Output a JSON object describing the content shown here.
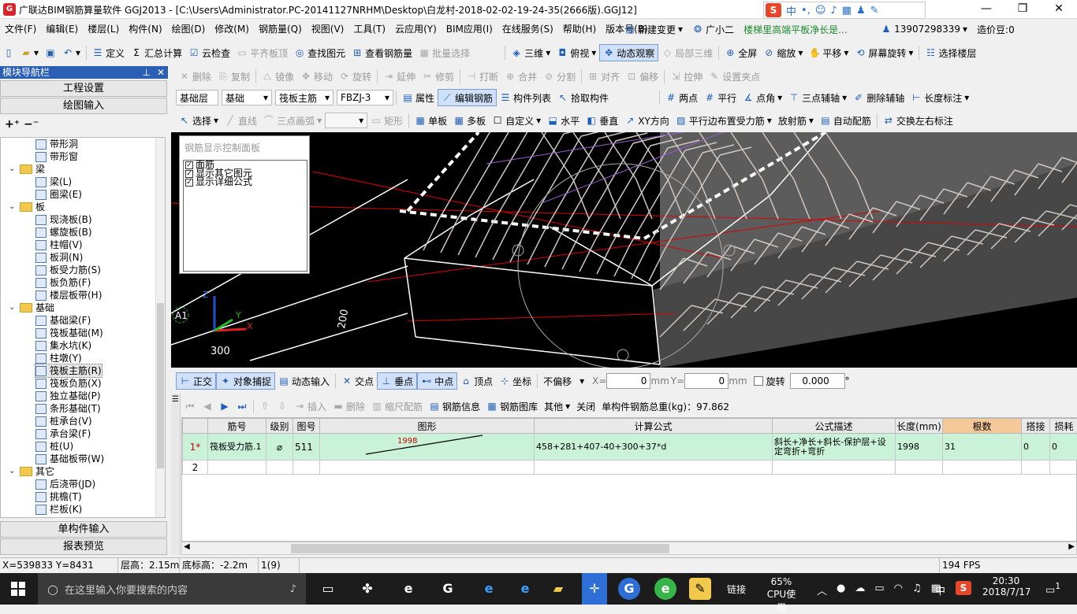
{
  "window": {
    "title": "广联达BIM钢筋算量软件 GGJ2013 - [C:\\Users\\Administrator.PC-20141127NRHM\\Desktop\\白龙村-2018-02-02-19-24-35(2666版).GGJ12]",
    "minimize": "—",
    "restore": "❐",
    "close": "✕"
  },
  "ime": {
    "logo": "S",
    "mode": "中"
  },
  "menu": [
    "文件(F)",
    "编辑(E)",
    "楼层(L)",
    "构件(N)",
    "绘图(D)",
    "修改(M)",
    "钢筋量(Q)",
    "视图(V)",
    "工具(T)",
    "云应用(Y)",
    "BIM应用(I)",
    "在线服务(S)",
    "帮助(H)",
    "版本号(B)"
  ],
  "menu_right": {
    "new_change": "新建变更",
    "assistant": "广小二",
    "notice": "楼梯里高端平板净长是...",
    "phone": "13907298339",
    "credit": "造价豆:0"
  },
  "toolbar1": {
    "define": "定义",
    "sum": "汇总计算",
    "cloud_check": "云检查",
    "flat_top": "平齐板顶",
    "find": "查找图元",
    "view_rebar": "查看钢筋量",
    "batch": "批量选择",
    "view3d": "三维",
    "top_view": "俯视",
    "dynamic": "动态观察",
    "local3d": "局部三维",
    "fullscreen": "全屏",
    "zoom": "缩放",
    "pan": "平移",
    "rotate_screen": "屏幕旋转",
    "select_floor": "选择楼层"
  },
  "toolbar2": [
    "删除",
    "复制",
    "镜像",
    "移动",
    "旋转",
    "延伸",
    "修剪",
    "打断",
    "合并",
    "分割",
    "对齐",
    "偏移",
    "拉伸",
    "设置夹点"
  ],
  "toolbar3": {
    "layer": "基础层",
    "type": "基础",
    "member": "筏板主筋",
    "name": "FBZJ-3",
    "props": "属性",
    "edit_rebar": "编辑钢筋",
    "list": "构件列表",
    "pick": "拾取构件",
    "two_point": "两点",
    "parallel": "平行",
    "point_angle": "点角",
    "three_point_aux": "三点辅轴",
    "del_aux": "删除辅轴",
    "dim": "长度标注"
  },
  "toolbar4": {
    "select": "选择",
    "line": "直线",
    "arc": "三点画弧",
    "rect": "矩形",
    "single": "单板",
    "multi": "多板",
    "custom": "自定义",
    "horizontal": "水平",
    "vertical": "垂直",
    "xy": "XY方向",
    "parallel_edge": "平行边布置受力筋",
    "radial": "放射筋",
    "auto": "自动配筋",
    "swap": "交换左右标注"
  },
  "panel": {
    "title": "模块导航栏",
    "engineering": "工程设置",
    "drawing": "绘图输入",
    "single_input": "单构件输入",
    "report": "报表预览"
  },
  "tree": [
    {
      "label": "带形洞",
      "level": 2,
      "folder": false
    },
    {
      "label": "带形窗",
      "level": 2,
      "folder": false
    },
    {
      "label": "梁",
      "level": 1,
      "folder": true
    },
    {
      "label": "梁(L)",
      "level": 2,
      "folder": false
    },
    {
      "label": "圈梁(E)",
      "level": 2,
      "folder": false
    },
    {
      "label": "板",
      "level": 1,
      "folder": true
    },
    {
      "label": "现浇板(B)",
      "level": 2,
      "folder": false
    },
    {
      "label": "螺旋板(B)",
      "level": 2,
      "folder": false
    },
    {
      "label": "柱帽(V)",
      "level": 2,
      "folder": false
    },
    {
      "label": "板洞(N)",
      "level": 2,
      "folder": false
    },
    {
      "label": "板受力筋(S)",
      "level": 2,
      "folder": false
    },
    {
      "label": "板负筋(F)",
      "level": 2,
      "folder": false
    },
    {
      "label": "楼层板带(H)",
      "level": 2,
      "folder": false
    },
    {
      "label": "基础",
      "level": 1,
      "folder": true
    },
    {
      "label": "基础梁(F)",
      "level": 2,
      "folder": false
    },
    {
      "label": "筏板基础(M)",
      "level": 2,
      "folder": false
    },
    {
      "label": "集水坑(K)",
      "level": 2,
      "folder": false
    },
    {
      "label": "柱墩(Y)",
      "level": 2,
      "folder": false
    },
    {
      "label": "筏板主筋(R)",
      "level": 2,
      "folder": false
    },
    {
      "label": "筏板负筋(X)",
      "level": 2,
      "folder": false
    },
    {
      "label": "独立基础(P)",
      "level": 2,
      "folder": false
    },
    {
      "label": "条形基础(T)",
      "level": 2,
      "folder": false
    },
    {
      "label": "桩承台(V)",
      "level": 2,
      "folder": false
    },
    {
      "label": "承台梁(F)",
      "level": 2,
      "folder": false
    },
    {
      "label": "桩(U)",
      "level": 2,
      "folder": false
    },
    {
      "label": "基础板带(W)",
      "level": 2,
      "folder": false
    },
    {
      "label": "其它",
      "level": 1,
      "folder": true
    },
    {
      "label": "后浇带(JD)",
      "level": 2,
      "folder": false
    },
    {
      "label": "挑檐(T)",
      "level": 2,
      "folder": false
    },
    {
      "label": "栏板(K)",
      "level": 2,
      "folder": false
    }
  ],
  "ctrl_panel": {
    "title": "钢筋显示控制面板",
    "items": [
      "面筋",
      "显示其它图元",
      "显示详细公式"
    ]
  },
  "canvas": {
    "axis_label": "A1",
    "dim1": "200",
    "dim2": "300",
    "z": "Z",
    "x": "X",
    "y": "Y"
  },
  "snapbar": {
    "ortho": "正交",
    "snap": "对象捕捉",
    "dyn_input": "动态输入",
    "intersection": "交点",
    "perp": "垂点",
    "mid": "中点",
    "vertex": "顶点",
    "coord": "坐标",
    "offset_mode": "不偏移",
    "x_label": "X=",
    "x_val": "0",
    "y_label": "Y=",
    "y_val": "0",
    "unit": "mm",
    "rotate": "旋转",
    "rotate_val": "0.000",
    "deg": "°"
  },
  "gridbar": {
    "insert": "插入",
    "delete": "删除",
    "scale": "缩尺配筋",
    "info": "钢筋信息",
    "lib": "钢筋图库",
    "other": "其他",
    "close": "关闭",
    "weight": "单构件钢筋总重(kg)：97.862"
  },
  "grid": {
    "headers": [
      "筋号",
      "级别",
      "图号",
      "图形",
      "计算公式",
      "公式描述",
      "长度(mm)",
      "根数",
      "搭接",
      "损耗"
    ],
    "rows": [
      {
        "idx": "1*",
        "name": "筏板受力筋.1",
        "grade": "⌀",
        "fig": "511",
        "shape_label": "1998",
        "formula": "458+281+407-40+300+37*d",
        "desc": "斜长+净长+斜长-保护层+设定弯折+弯折",
        "length": "1998",
        "count": "31",
        "lap": "0",
        "loss": "0"
      },
      {
        "idx": "2",
        "name": "",
        "grade": "",
        "fig": "",
        "shape_label": "",
        "formula": "",
        "desc": "",
        "length": "",
        "count": "",
        "lap": "",
        "loss": ""
      }
    ]
  },
  "status": {
    "coords": "X=539833 Y=8431",
    "floor_height": "层高：2.15m",
    "base_height": "底标高：-2.2m",
    "sel": "1(9)",
    "fps": "194 FPS"
  },
  "taskbar": {
    "search_placeholder": "在这里输入你要搜索的内容",
    "link": "链接",
    "cpu_pct": "65%",
    "cpu_label": "CPU使用",
    "ime": "中",
    "time": "20:30",
    "date": "2018/7/17",
    "notif": "1"
  }
}
